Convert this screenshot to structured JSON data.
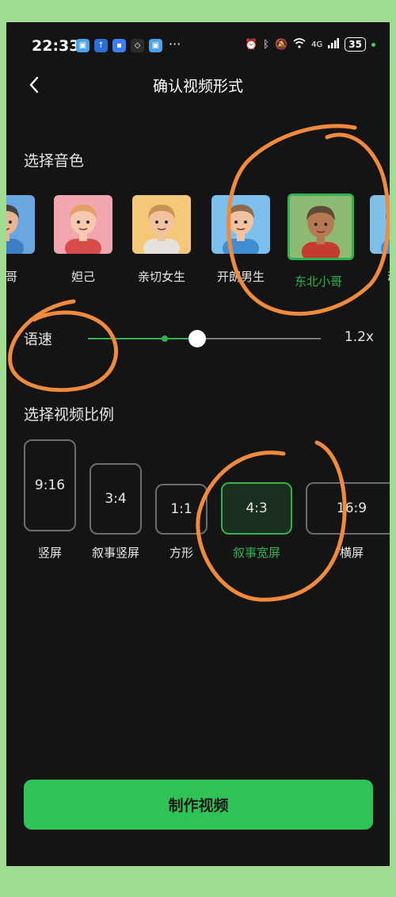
{
  "status_bar": {
    "time": "22:33",
    "app_icons": [
      {
        "icon": "app-notification-icon",
        "color": "#4aa3e8",
        "glyph": "▣"
      },
      {
        "icon": "upload-icon",
        "color": "#2a6fd6",
        "glyph": "↑"
      },
      {
        "icon": "message-icon",
        "color": "#3d7ef0",
        "glyph": "▪"
      },
      {
        "icon": "app-icon",
        "color": "#2b2b2b",
        "glyph": "◇"
      },
      {
        "icon": "app-notification-icon",
        "color": "#4aa3e8",
        "glyph": "▣"
      }
    ],
    "more": "···",
    "network": "4G",
    "battery": "35"
  },
  "nav": {
    "title": "确认视频形式"
  },
  "voice_section": {
    "title": "选择音色",
    "voices": [
      {
        "label": "小哥",
        "bg": "#6aa6e0",
        "skin": "#e7b494",
        "hair": "#444444",
        "shirt": "#3b7fc4",
        "selected": false
      },
      {
        "label": "妲己",
        "bg": "#f2a6b0",
        "skin": "#f6c9b0",
        "hair": "#e59f62",
        "shirt": "#d94c4c",
        "selected": false
      },
      {
        "label": "亲切女生",
        "bg": "#f5c878",
        "skin": "#f2c29d",
        "hair": "#c79352",
        "shirt": "#e5e2de",
        "selected": false
      },
      {
        "label": "开朗男生",
        "bg": "#7dbfed",
        "skin": "#f1c3a0",
        "hair": "#8c6c4e",
        "shirt": "#3f8ed4",
        "selected": false
      },
      {
        "label": "东北小哥",
        "bg": "#8ebb74",
        "skin": "#b57a54",
        "hair": "#5e4a36",
        "shirt": "#c53b2f",
        "selected": true
      },
      {
        "label": "动漫",
        "bg": "#7fbfe8",
        "skin": "#f2c8a8",
        "hair": "#6b5a4a",
        "shirt": "#4a8ad0",
        "selected": false
      }
    ]
  },
  "speed": {
    "label": "语速",
    "value_text": "1.2x",
    "slider_fraction": 0.47,
    "mark_fraction": 0.33
  },
  "ratio_section": {
    "title": "选择视频比例",
    "ratios": [
      {
        "value": "9:16",
        "label": "竖屏",
        "selected": false
      },
      {
        "value": "3:4",
        "label": "叙事竖屏",
        "selected": false
      },
      {
        "value": "1:1",
        "label": "方形",
        "selected": false
      },
      {
        "value": "4:3",
        "label": "叙事宽屏",
        "selected": true
      },
      {
        "value": "16:9",
        "label": "横屏",
        "selected": false
      }
    ]
  },
  "cta": {
    "label": "制作视频"
  },
  "colors": {
    "accent": "#2fb24f",
    "button": "#2fc257",
    "annotation": "#f08a3c",
    "background": "#141414"
  }
}
